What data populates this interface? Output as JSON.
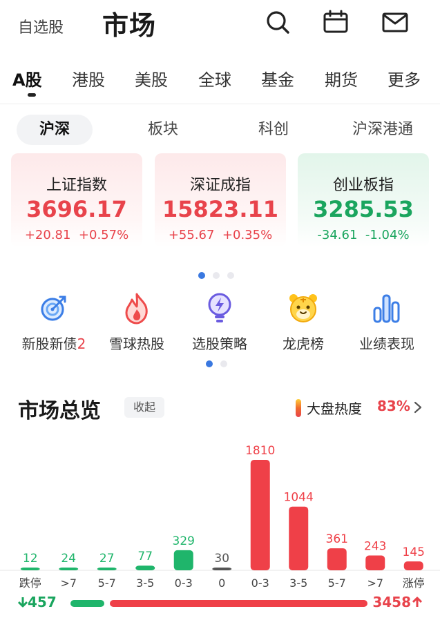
{
  "header": {
    "watchlist_label": "自选股",
    "title": "市场",
    "icons": [
      "search-icon",
      "calendar-icon",
      "mail-icon"
    ]
  },
  "market_tabs": [
    {
      "label": "A股",
      "active": true
    },
    {
      "label": "港股"
    },
    {
      "label": "美股"
    },
    {
      "label": "全球"
    },
    {
      "label": "基金"
    },
    {
      "label": "期货"
    },
    {
      "label": "更多"
    }
  ],
  "sub_tabs": [
    {
      "label": "沪深",
      "active": true
    },
    {
      "label": "板块"
    },
    {
      "label": "科创"
    },
    {
      "label": "沪深港通"
    }
  ],
  "indices": [
    {
      "name": "上证指数",
      "value": "3696.17",
      "change": "+20.81",
      "pct": "+0.57%",
      "trend": "up"
    },
    {
      "name": "深证成指",
      "value": "15823.11",
      "change": "+55.67",
      "pct": "+0.35%",
      "trend": "up"
    },
    {
      "name": "创业板指",
      "value": "3285.53",
      "change": "-34.61",
      "pct": "-1.04%",
      "trend": "down"
    }
  ],
  "shortcuts": [
    {
      "label": "新股新债",
      "badge": "2",
      "icon": "target-icon"
    },
    {
      "label": "雪球热股",
      "icon": "flame-icon"
    },
    {
      "label": "选股策略",
      "icon": "bulb-icon"
    },
    {
      "label": "龙虎榜",
      "icon": "tiger-icon"
    },
    {
      "label": "业绩表现",
      "icon": "bar-chart-icon"
    }
  ],
  "overview": {
    "title": "市场总览",
    "collapse_label": "收起",
    "heat_label": "大盘热度",
    "heat_value": "83%",
    "down_total": "457",
    "up_total": "3458"
  },
  "colors": {
    "up": "#ef4048",
    "down": "#1fb56b",
    "flat": "#555555"
  },
  "chart_data": {
    "type": "bar",
    "categories": [
      "跌停",
      ">7",
      "5-7",
      "3-5",
      "0-3",
      "0",
      "0-3",
      "3-5",
      "5-7",
      ">7",
      "涨停"
    ],
    "values": [
      12,
      24,
      27,
      77,
      329,
      30,
      1810,
      1044,
      361,
      243,
      145
    ],
    "bar_colors": [
      "down",
      "down",
      "down",
      "down",
      "down",
      "flat",
      "up",
      "up",
      "up",
      "up",
      "up"
    ],
    "title": "",
    "xlabel": "",
    "ylabel": ""
  }
}
